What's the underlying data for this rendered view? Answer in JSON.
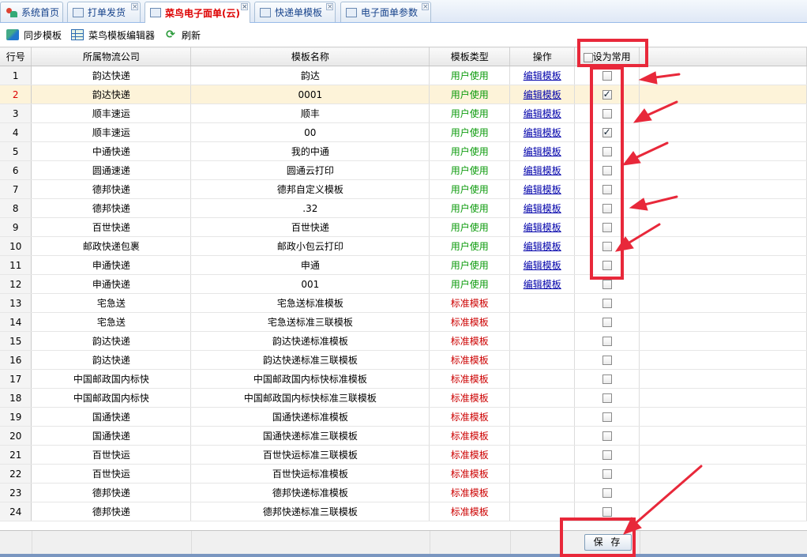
{
  "tabs": [
    {
      "label": "系统首页",
      "icon": "home-icon",
      "closable": false
    },
    {
      "label": "打单发货",
      "icon": "grid-icon",
      "closable": true
    },
    {
      "label": "菜鸟电子面单(云)",
      "icon": "grid-icon",
      "closable": true,
      "active": true
    },
    {
      "label": "快递单模板",
      "icon": "grid-icon",
      "closable": true
    },
    {
      "label": "电子面单参数",
      "icon": "grid-icon",
      "closable": true
    }
  ],
  "toolbar": {
    "sync_label": "同步模板",
    "editor_label": "菜鸟模板编辑器",
    "refresh_label": "刷新"
  },
  "columns": {
    "row": "行号",
    "company": "所属物流公司",
    "name": "模板名称",
    "type": "模板类型",
    "op": "操作",
    "common": "设为常用"
  },
  "rows": [
    {
      "n": "1",
      "company": "韵达快递",
      "name": "韵达",
      "type": "用户使用",
      "op": "编辑模板",
      "checked": false
    },
    {
      "n": "2",
      "company": "韵达快递",
      "name": "0001",
      "type": "用户使用",
      "op": "编辑模板",
      "checked": true,
      "selected": true
    },
    {
      "n": "3",
      "company": "顺丰速运",
      "name": "顺丰",
      "type": "用户使用",
      "op": "编辑模板",
      "checked": false
    },
    {
      "n": "4",
      "company": "顺丰速运",
      "name": "00",
      "type": "用户使用",
      "op": "编辑模板",
      "checked": true
    },
    {
      "n": "5",
      "company": "中通快递",
      "name": "我的中通",
      "type": "用户使用",
      "op": "编辑模板",
      "checked": false
    },
    {
      "n": "6",
      "company": "圆通速递",
      "name": "圆通云打印",
      "type": "用户使用",
      "op": "编辑模板",
      "checked": false
    },
    {
      "n": "7",
      "company": "德邦快递",
      "name": "德邦自定义模板",
      "type": "用户使用",
      "op": "编辑模板",
      "checked": false
    },
    {
      "n": "8",
      "company": "德邦快递",
      "name": ".32",
      "type": "用户使用",
      "op": "编辑模板",
      "checked": false
    },
    {
      "n": "9",
      "company": "百世快递",
      "name": "百世快递",
      "type": "用户使用",
      "op": "编辑模板",
      "checked": false
    },
    {
      "n": "10",
      "company": "邮政快递包裹",
      "name": "邮政小包云打印",
      "type": "用户使用",
      "op": "编辑模板",
      "checked": false
    },
    {
      "n": "11",
      "company": "申通快递",
      "name": "申通",
      "type": "用户使用",
      "op": "编辑模板",
      "checked": false
    },
    {
      "n": "12",
      "company": "申通快递",
      "name": "001",
      "type": "用户使用",
      "op": "编辑模板",
      "checked": false
    },
    {
      "n": "13",
      "company": "宅急送",
      "name": "宅急送标准模板",
      "type": "标准模板",
      "op": "",
      "checked": false
    },
    {
      "n": "14",
      "company": "宅急送",
      "name": "宅急送标准三联模板",
      "type": "标准模板",
      "op": "",
      "checked": false
    },
    {
      "n": "15",
      "company": "韵达快递",
      "name": "韵达快递标准模板",
      "type": "标准模板",
      "op": "",
      "checked": false
    },
    {
      "n": "16",
      "company": "韵达快递",
      "name": "韵达快递标准三联模板",
      "type": "标准模板",
      "op": "",
      "checked": false
    },
    {
      "n": "17",
      "company": "中国邮政国内标快",
      "name": "中国邮政国内标快标准模板",
      "type": "标准模板",
      "op": "",
      "checked": false
    },
    {
      "n": "18",
      "company": "中国邮政国内标快",
      "name": "中国邮政国内标快标准三联模板",
      "type": "标准模板",
      "op": "",
      "checked": false
    },
    {
      "n": "19",
      "company": "国通快递",
      "name": "国通快递标准模板",
      "type": "标准模板",
      "op": "",
      "checked": false
    },
    {
      "n": "20",
      "company": "国通快递",
      "name": "国通快递标准三联模板",
      "type": "标准模板",
      "op": "",
      "checked": false
    },
    {
      "n": "21",
      "company": "百世快运",
      "name": "百世快运标准三联模板",
      "type": "标准模板",
      "op": "",
      "checked": false
    },
    {
      "n": "22",
      "company": "百世快运",
      "name": "百世快运标准模板",
      "type": "标准模板",
      "op": "",
      "checked": false
    },
    {
      "n": "23",
      "company": "德邦快递",
      "name": "德邦快递标准模板",
      "type": "标准模板",
      "op": "",
      "checked": false
    },
    {
      "n": "24",
      "company": "德邦快递",
      "name": "德邦快递标准三联模板",
      "type": "标准模板",
      "op": "",
      "checked": false
    }
  ],
  "footer": {
    "save_label": "保 存"
  },
  "colors": {
    "user_type": "#0a9a0a",
    "standard_type": "#cc0000",
    "annotation": "#e8283a",
    "selected_row": "#fdf3d9"
  }
}
